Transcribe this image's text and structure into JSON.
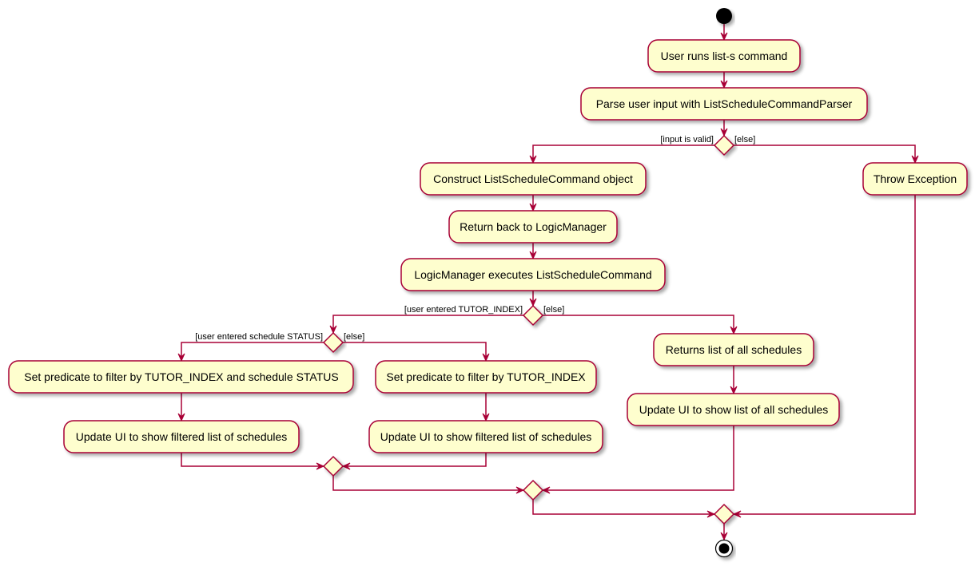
{
  "diagram": {
    "type": "activity",
    "colors": {
      "line": "#A80036",
      "activity_fill": "#FEFECE",
      "start_node": "#000000",
      "background": "#FFFFFF"
    },
    "activities": {
      "user_runs": "User runs list-s command",
      "parse_input": "Parse user input with ListScheduleCommandParser",
      "construct_command": "Construct ListScheduleCommand object",
      "throw_exception": "Throw Exception",
      "return_logic": "Return back to LogicManager",
      "logic_executes": "LogicManager executes ListScheduleCommand",
      "predicate_index_status": "Set predicate to filter by TUTOR_INDEX and schedule STATUS",
      "predicate_index": "Set predicate to filter by TUTOR_INDEX",
      "returns_all": "Returns list of all schedules",
      "update_filtered_1": "Update UI to show filtered list of schedules",
      "update_filtered_2": "Update UI to show filtered list of schedules",
      "update_all": "Update UI to show list of all schedules"
    },
    "guards": {
      "input_valid": "[input is valid]",
      "input_else": "[else]",
      "tutor_index": "[user entered TUTOR_INDEX]",
      "tutor_else": "[else]",
      "status": "[user entered schedule STATUS]",
      "status_else": "[else]"
    }
  }
}
